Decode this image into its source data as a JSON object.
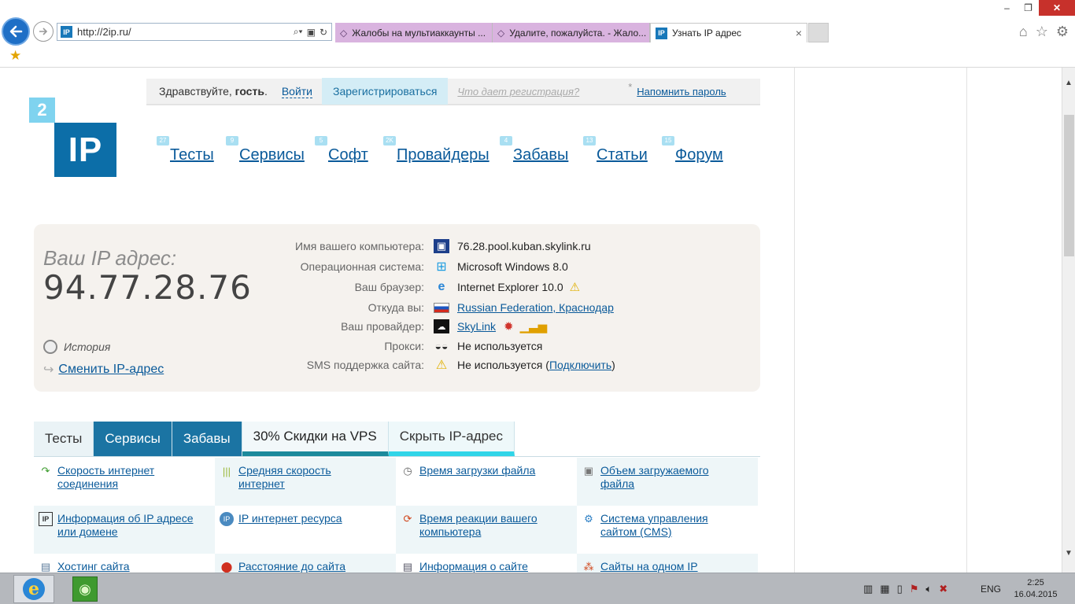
{
  "browser": {
    "url": "http://2ip.ru/",
    "site_icon": "IP",
    "tabs": [
      {
        "label": "Жалобы на мультиаккаунты ..."
      },
      {
        "label": "Удалите, пожалуйста. - Жало..."
      },
      {
        "label": "Узнать IP адрес"
      }
    ],
    "tab_close": "×"
  },
  "site": {
    "greeting_prefix": "Здравствуйте, ",
    "greeting_user": "гость",
    "greeting_suffix": ".",
    "login": "Войти",
    "register": "Зарегистрироваться",
    "what_gives": "Что дает регистрация?",
    "remind_star": "*",
    "remind_password": "Напомнить пароль",
    "logo_small": "2",
    "logo_big": "IP"
  },
  "nav": [
    {
      "label": "Тесты",
      "badge": "27"
    },
    {
      "label": "Сервисы",
      "badge": "9"
    },
    {
      "label": "Софт",
      "badge": "5"
    },
    {
      "label": "Провайдеры",
      "badge": "2K"
    },
    {
      "label": "Забавы",
      "badge": "4"
    },
    {
      "label": "Статьи",
      "badge": "13"
    },
    {
      "label": "Форум",
      "badge": "15"
    }
  ],
  "ip_info": {
    "title": "Ваш IP адрес:",
    "ip": "94.77.28.76",
    "history": "История",
    "change_ip": "Сменить IP-адрес",
    "rows": [
      {
        "label": "Имя вашего компьютера:",
        "value": "76.28.pool.kuban.skylink.ru",
        "icon": "computer-icon"
      },
      {
        "label": "Операционная система:",
        "value": "Microsoft Windows 8.0",
        "icon": "windows-icon"
      },
      {
        "label": "Ваш браузер:",
        "value": "Internet Explorer 10.0",
        "icon": "ie-icon"
      },
      {
        "label": "Откуда вы:",
        "value": "Russian Federation, Краснодар",
        "icon": "flag-ru-icon"
      },
      {
        "label": "Ваш провайдер:",
        "value": "SkyLink",
        "icon": "provider-icon"
      },
      {
        "label": "Прокси:",
        "value": "Не используется",
        "icon": "glasses-icon"
      },
      {
        "label": "SMS поддержка сайта:",
        "value": "Не используется",
        "icon": "warning-icon"
      }
    ],
    "sms_open": " (",
    "sms_link": "Подключить",
    "sms_close": ")"
  },
  "service_tabs": [
    {
      "label": "Тесты"
    },
    {
      "label": "Сервисы"
    },
    {
      "label": "Забавы"
    },
    {
      "label": "30% Скидки на VPS"
    },
    {
      "label": "Скрыть IP-адрес"
    }
  ],
  "services": [
    {
      "line1": "Скорость интернет",
      "line2": "соединения",
      "icon": "speed-arrow-icon"
    },
    {
      "line1": "Средняя скорость",
      "line2": "интернет",
      "icon": "bars-icon"
    },
    {
      "line1": "Время загрузки файла",
      "line2": "",
      "icon": "clock-icon"
    },
    {
      "line1": "Объем загружаемого",
      "line2": "файла",
      "icon": "file-size-icon"
    },
    {
      "line1": "Информация об IP адресе",
      "line2": "или домене",
      "icon": "ip-info-icon"
    },
    {
      "line1": "IP интернет ресурса",
      "line2": "",
      "icon": "ip-resource-icon"
    },
    {
      "line1": "Время реакции вашего",
      "line2": "компьютера",
      "icon": "reaction-icon"
    },
    {
      "line1": "Система управления",
      "line2": "сайтом (CMS)",
      "icon": "cms-gear-icon"
    },
    {
      "line1": "Хостинг сайта",
      "line2": "",
      "icon": "hosting-icon"
    },
    {
      "line1": "Расстояние до сайта",
      "line2": "",
      "icon": "map-pin-icon"
    },
    {
      "line1": "Информация о сайте",
      "line2": "",
      "icon": "site-info-icon"
    },
    {
      "line1": "Сайты на одном IP",
      "line2": "",
      "icon": "network-icon"
    }
  ],
  "taskbar": {
    "lang": "ENG",
    "time": "2:25",
    "date": "16.04.2015"
  }
}
